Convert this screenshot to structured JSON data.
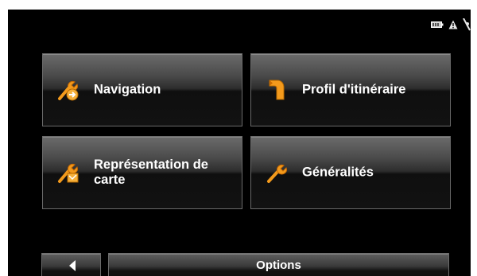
{
  "status_icons": [
    "battery-icon",
    "warning-icon",
    "gps-signal-icon"
  ],
  "menu": {
    "tiles": [
      {
        "label": "Navigation",
        "icon": "wrench-arrow-icon"
      },
      {
        "label": "Profil d'itinéraire",
        "icon": "route-profile-icon"
      },
      {
        "label": "Représentation de carte",
        "icon": "wrench-map-icon"
      },
      {
        "label": "Généralités",
        "icon": "wrench-icon"
      }
    ]
  },
  "footer": {
    "back_icon": "back-arrow-icon",
    "title": "Options"
  },
  "colors": {
    "background": "#000000",
    "text": "#ffffff",
    "accent_orange": "#f39a1c"
  }
}
